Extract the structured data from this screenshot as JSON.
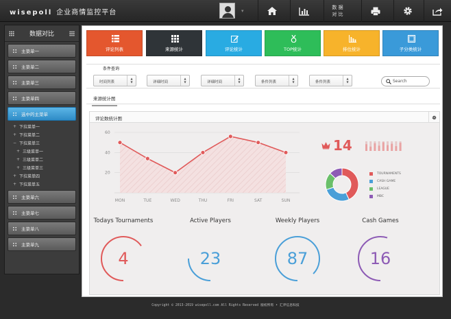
{
  "header": {
    "brand": "wisepoll",
    "app_title": "企业商情监控平台",
    "compare_label": "数 据\n对 比",
    "caret": "▾"
  },
  "sidebar": {
    "title": "数据对比",
    "items_top": [
      {
        "label": "主菜单一"
      },
      {
        "label": "主菜单二"
      },
      {
        "label": "主菜单三"
      },
      {
        "label": "主菜单四"
      },
      {
        "label": "选中的主菜单"
      }
    ],
    "subitems": [
      {
        "mark": "+",
        "label": "下拉菜单一",
        "level": 1
      },
      {
        "mark": "+",
        "label": "下拉菜单二",
        "level": 1
      },
      {
        "mark": "−",
        "label": "下拉菜单三",
        "level": 1
      },
      {
        "mark": "+",
        "label": "三级菜单一",
        "level": 2
      },
      {
        "mark": "+",
        "label": "三级菜单二",
        "level": 2
      },
      {
        "mark": "+",
        "label": "三级菜单三",
        "level": 2
      },
      {
        "mark": "+",
        "label": "下拉菜单四",
        "level": 1
      },
      {
        "mark": "+",
        "label": "下拉菜单五",
        "level": 1
      }
    ],
    "items_bottom": [
      {
        "label": "主菜单六"
      },
      {
        "label": "主菜单七"
      },
      {
        "label": "主菜单八"
      },
      {
        "label": "主菜单九"
      }
    ]
  },
  "tiles": [
    {
      "label": "评论列表",
      "color": "#e4572e",
      "icon": "list-icon"
    },
    {
      "label": "来源统计",
      "color": "#2f3438",
      "icon": "grid-icon"
    },
    {
      "label": "评论统计",
      "color": "#29abe2",
      "icon": "edit-icon"
    },
    {
      "label": "TOP统计",
      "color": "#2ebd59",
      "icon": "medal-icon"
    },
    {
      "label": "排位统计",
      "color": "#f7b32b",
      "icon": "bar-chart-icon"
    },
    {
      "label": "子分类统计",
      "color": "#3a9ad9",
      "icon": "square-icon"
    }
  ],
  "filters": {
    "legend": "条件查询",
    "selects": [
      {
        "value": "时间列表"
      },
      {
        "value": "详细时间"
      },
      {
        "value": "详细时间"
      },
      {
        "value": "条件列表"
      },
      {
        "value": "条件列表"
      }
    ],
    "search_placeholder": "Search"
  },
  "tab_label": "来源统计图",
  "panel_title": "评论数统计图",
  "chart_data": {
    "type": "line",
    "categories": [
      "MON",
      "TUE",
      "WED",
      "THU",
      "FRI",
      "SAT",
      "SUN"
    ],
    "values": [
      50,
      34,
      20,
      40,
      56,
      50,
      40
    ],
    "ylim": [
      0,
      60
    ],
    "yticks": [
      "60",
      "40",
      "20"
    ],
    "grid": true,
    "color": "#e05a5a"
  },
  "rank": {
    "value": "14",
    "crown_icon": "crown-icon",
    "color": "#e05a5a",
    "mini_bars": [
      0.7,
      0.45,
      0.8,
      0.55,
      0.9,
      0.6,
      0.75,
      0.5,
      0.85
    ]
  },
  "donut": {
    "segments": [
      {
        "name": "TOURNAMENTS",
        "value": 43,
        "color": "#e05a5a"
      },
      {
        "name": "CASH GAME",
        "value": 27,
        "color": "#4a9fd8"
      },
      {
        "name": "LEAGUE",
        "value": 17,
        "color": "#6abf69"
      },
      {
        "name": "MBC",
        "value": 13,
        "color": "#8d5bb5"
      }
    ]
  },
  "stats": [
    {
      "title": "Todays Tournaments",
      "value": "4",
      "color": "#e05a5a",
      "fraction": 0.65
    },
    {
      "title": "Active Players",
      "value": "23",
      "color": "#4a9fd8",
      "fraction": 0.25
    },
    {
      "title": "Weekly Players",
      "value": "87",
      "color": "#4a9fd8",
      "fraction": 0.87
    },
    {
      "title": "Cash Games",
      "value": "16",
      "color": "#8d5bb5",
      "fraction": 0.55
    }
  ],
  "footer": "Copyright © 2013-2019 wisepoll.com All Rights Reserved 版权所有 • 汇评信息科技"
}
